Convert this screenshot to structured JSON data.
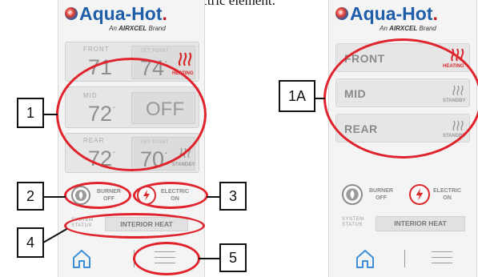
{
  "intro_text": "oil burner and/or the electric element.",
  "brand": {
    "name": "Aqua-Hot",
    "suffix": ".",
    "tagline_pre": "An",
    "tagline_brand": "AIRXCEL",
    "tagline_post": "Brand"
  },
  "left_panel": {
    "zones": [
      {
        "label": "FRONT",
        "temp": "71",
        "setpoint_label": "SET POINT",
        "setpoint": "74",
        "status": "HEATING",
        "status_color": "#d8282a"
      },
      {
        "label": "MID",
        "temp": "72",
        "setpoint_value": "OFF"
      },
      {
        "label": "REAR",
        "temp": "72",
        "setpoint_label": "SET POINT",
        "setpoint": "70",
        "status": "STANDBY"
      }
    ],
    "burner": {
      "label": "BURNER",
      "state": "OFF"
    },
    "electric": {
      "label": "ELECTRIC",
      "state": "ON"
    },
    "system_status": {
      "label": "SYSTEM STATUS",
      "label_line1": "SYSTEM",
      "label_line2": "STATUS",
      "value": "INTERIOR HEAT"
    }
  },
  "right_panel": {
    "zones": [
      {
        "label": "FRONT",
        "status": "HEATING",
        "status_color": "#d8282a"
      },
      {
        "label": "MID",
        "status": "STANDBY"
      },
      {
        "label": "REAR",
        "status": "STANDBY"
      }
    ],
    "burner": {
      "label": "BURNER",
      "state": "OFF"
    },
    "electric": {
      "label": "ELECTRIC",
      "state": "ON"
    },
    "system_status": {
      "label_line1": "SYSTEM",
      "label_line2": "STATUS",
      "value": "INTERIOR HEAT"
    }
  },
  "callouts": [
    "1",
    "2",
    "3",
    "4",
    "5",
    "1A"
  ],
  "icons": {
    "heating": "heat-waves-icon",
    "standby": "standby-waves-icon",
    "burner": "flame-icon",
    "electric": "lightning-icon",
    "home": "home-icon",
    "menu": "hamburger-menu-icon"
  },
  "colors": {
    "accent_red": "#e0242e",
    "brand_blue": "#1f5ea8"
  }
}
